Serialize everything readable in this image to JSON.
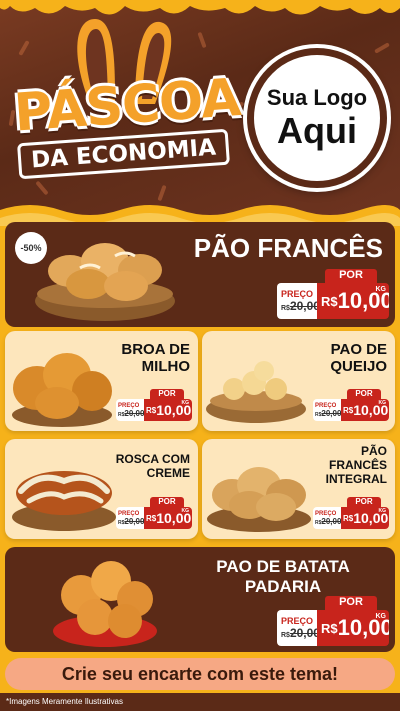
{
  "header": {
    "title_main": "PÁSCOA",
    "title_sub": "DA ECONOMIA",
    "logo_line1": "Sua Logo",
    "logo_line2": "Aqui"
  },
  "products": [
    {
      "name": "PÃO FRANCÊS",
      "badge": "-50%",
      "tag": {
        "por": "POR",
        "preco": "PREÇO",
        "de": "R$",
        "old": "20,00",
        "cur": "R$",
        "value": "10,00",
        "unit": "KG"
      }
    },
    {
      "name": "BROA DE MILHO",
      "tag": {
        "por": "POR",
        "preco": "PREÇO",
        "de": "R$",
        "old": "20,00",
        "cur": "R$",
        "value": "10,00",
        "unit": "KG"
      }
    },
    {
      "name": "PAO DE QUEIJO",
      "tag": {
        "por": "POR",
        "preco": "PREÇO",
        "de": "R$",
        "old": "20,00",
        "cur": "R$",
        "value": "10,00",
        "unit": "KG"
      }
    },
    {
      "name": "ROSCA COM CREME",
      "tag": {
        "por": "POR",
        "preco": "PREÇO",
        "de": "R$",
        "old": "20,00",
        "cur": "R$",
        "value": "10,00",
        "unit": "KG"
      }
    },
    {
      "name": "PÃO FRANCÊS INTEGRAL",
      "tag": {
        "por": "POR",
        "preco": "PREÇO",
        "de": "R$",
        "old": "20,00",
        "cur": "R$",
        "value": "10,00",
        "unit": "KG"
      }
    },
    {
      "name": "PAO DE BATATA PADARIA",
      "tag": {
        "por": "POR",
        "preco": "PREÇO",
        "de": "R$",
        "old": "20,00",
        "cur": "R$",
        "value": "10,00",
        "unit": "KG"
      }
    }
  ],
  "cta": "Crie seu encarte com este tema!",
  "footer": "*Imagens Meramente Ilustrativas",
  "colors": {
    "brown": "#5b2a17",
    "yellow": "#f6b21a",
    "red": "#c8241c",
    "orange": "#f4a12a"
  }
}
